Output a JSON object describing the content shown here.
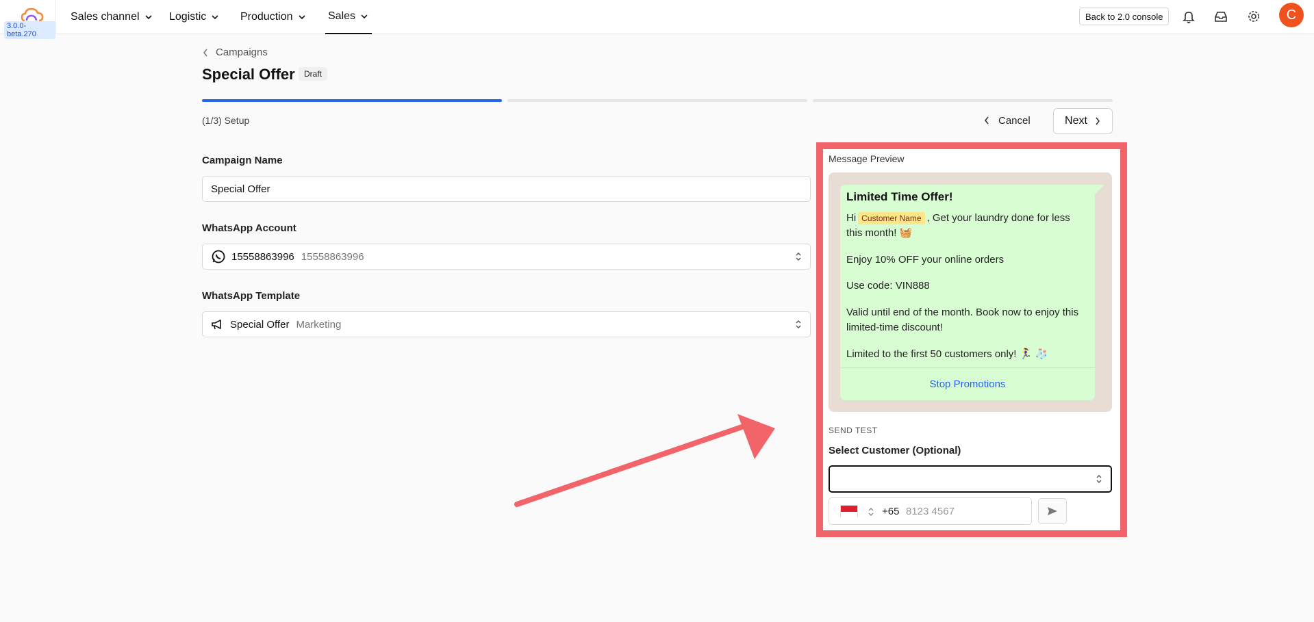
{
  "nav": {
    "version": "3.0.0-beta.270",
    "items": [
      {
        "label": "Sales channel"
      },
      {
        "label": "Logistic"
      },
      {
        "label": "Production"
      },
      {
        "label": "Sales"
      }
    ],
    "back_button": "Back to 2.0 console",
    "avatar_initial": "C"
  },
  "header": {
    "breadcrumb": "Campaigns",
    "title": "Special Offer",
    "status_badge": "Draft",
    "step_label": "(1/3) Setup",
    "cancel_label": "Cancel",
    "next_label": "Next"
  },
  "form": {
    "campaign_name_label": "Campaign Name",
    "campaign_name_value": "Special Offer",
    "whatsapp_account_label": "WhatsApp Account",
    "whatsapp_account_value": "15558863996",
    "whatsapp_account_secondary": "15558863996",
    "whatsapp_template_label": "WhatsApp Template",
    "whatsapp_template_value": "Special Offer",
    "whatsapp_template_secondary": "Marketing"
  },
  "preview": {
    "title": "Message Preview",
    "message": {
      "heading": "Limited Time Offer!",
      "greeting_prefix": "Hi",
      "customer_chip": "Customer Name",
      "greeting_suffix": ", Get your laundry done for less this month! 🧺",
      "line2": "Enjoy 10% OFF your online orders",
      "line3": "Use code: VIN888",
      "line4": "Valid until end of the month. Book now to enjoy this limited-time discount!",
      "line5": "Limited to the first 50 customers only! 🏃‍♀️ 🧦",
      "stop_link": "Stop Promotions"
    },
    "send_test_label": "SEND TEST",
    "select_customer_label": "Select Customer (Optional)",
    "country_code": "+65",
    "phone_placeholder": "8123 4567"
  },
  "colors": {
    "accent": "#2563eb",
    "highlight_border": "#f0646a",
    "bubble": "#d9fdd3",
    "avatar": "#f0521f"
  }
}
